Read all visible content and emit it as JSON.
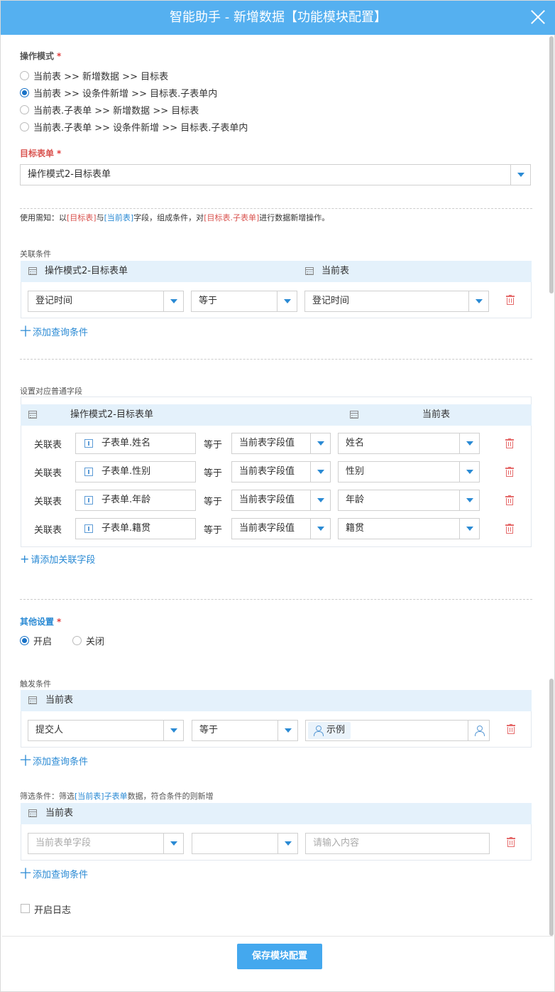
{
  "dialog": {
    "title": "智能助手 - 新增数据【功能模块配置】"
  },
  "operation_mode": {
    "label": "操作模式",
    "required": "*",
    "options": [
      "当前表 >> 新增数据 >> 目标表",
      "当前表 >> 设条件新增 >> 目标表.子表单内",
      "当前表.子表单 >> 新增数据 >> 目标表",
      "当前表.子表单 >> 设条件新增 >> 目标表.子表单内"
    ],
    "selected_index": 1
  },
  "target_form": {
    "label": "目标表单",
    "required": "*",
    "value": "操作模式2-目标表单"
  },
  "usage_note": {
    "prefix": "使用需知：以",
    "t1": "[目标表]",
    "mid1": "与",
    "t2": "[当前表]",
    "mid2": "字段，组成条件，对",
    "t3": "[目标表.子表单]",
    "suffix": "进行数据新增操作。"
  },
  "relation_conditions": {
    "label": "关联条件",
    "header_left": "操作模式2-目标表单",
    "header_right": "当前表",
    "rows": [
      {
        "left": "登记时间",
        "op": "等于",
        "right": "登记时间"
      }
    ],
    "add_label": "添加查询条件",
    "add_plus": "十"
  },
  "field_mapping": {
    "label": "设置对应普通字段",
    "header_left": "操作模式2-目标表单",
    "header_right": "当前表",
    "rows": [
      {
        "tag": "关联表",
        "field": "子表单.姓名",
        "op": "等于",
        "source": "当前表字段值",
        "value": "姓名"
      },
      {
        "tag": "关联表",
        "field": "子表单.性别",
        "op": "等于",
        "source": "当前表字段值",
        "value": "性别"
      },
      {
        "tag": "关联表",
        "field": "子表单.年龄",
        "op": "等于",
        "source": "当前表字段值",
        "value": "年龄"
      },
      {
        "tag": "关联表",
        "field": "子表单.籍贯",
        "op": "等于",
        "source": "当前表字段值",
        "value": "籍贯"
      }
    ],
    "add_label": "请添加关联字段",
    "add_plus": "+"
  },
  "other_settings": {
    "label": "其他设置",
    "required": "*",
    "on_label": "开启",
    "off_label": "关闭",
    "selected": "on"
  },
  "trigger_conditions": {
    "label": "触发条件",
    "header": "当前表",
    "row": {
      "field": "提交人",
      "op": "等于",
      "value": "示例"
    },
    "add_label": "添加查询条件",
    "add_plus": "十"
  },
  "filter_conditions": {
    "label_prefix": "筛选条件：筛选",
    "label_link": "[当前表]子表单",
    "label_suffix": "数据，符合条件的则新增",
    "header": "当前表",
    "row": {
      "field_placeholder": "当前表单字段",
      "op": "",
      "value_placeholder": "请输入内容"
    },
    "add_label": "添加查询条件",
    "add_plus": "十"
  },
  "log": {
    "label": "开启日志",
    "checked": false
  },
  "footer": {
    "save_label": "保存模块配置"
  },
  "colors": {
    "titlebar": "#55b0f0",
    "accent": "#2a8ad4",
    "danger": "#e56b6b",
    "panel_head": "#e4f1fb",
    "save_button": "#44a8ee"
  }
}
